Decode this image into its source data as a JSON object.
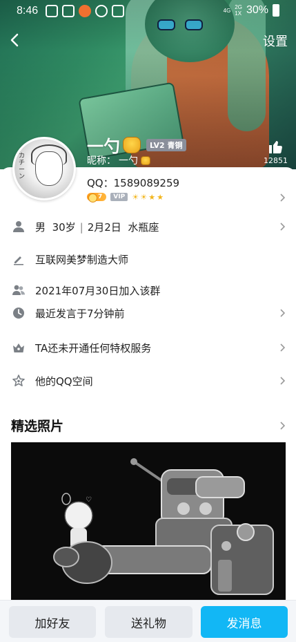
{
  "status_bar": {
    "time": "8:46",
    "net_top": "4G",
    "net_sim2": "2G",
    "net_sim2_sub": "1X",
    "battery": "30%"
  },
  "nav": {
    "settings_label": "设置"
  },
  "profile": {
    "name": "一勺",
    "level_badge": "LV2 青铜",
    "nickname_label": "昵称：",
    "nickname": "一勺",
    "like_count": "12851",
    "qq_label": "QQ：",
    "qq_number": "1589089259",
    "badge_gold_text": "7",
    "badge_vip_text": "VIP",
    "avatar_side_text": "カチーン"
  },
  "info_rows": [
    {
      "icon": "person-icon",
      "gender": "男",
      "age": "30岁",
      "birthday": "2月2日",
      "zodiac": "水瓶座"
    },
    {
      "icon": "pen-icon",
      "text": "互联网美梦制造大师"
    },
    {
      "icon": "group-icon",
      "text": "2021年07月30日加入该群"
    },
    {
      "icon": "clock-icon",
      "text": "最近发言于7分钟前"
    },
    {
      "icon": "privilege-icon",
      "text": "TA还未开通任何特权服务"
    },
    {
      "icon": "star-icon",
      "text": "他的QQ空间"
    }
  ],
  "photos_section": {
    "title": "精选照片"
  },
  "bottom_bar": {
    "add_friend": "加好友",
    "send_gift": "送礼物",
    "send_message": "发消息"
  },
  "colors": {
    "accent_blue": "#12b7f5",
    "banner_green": "#2f8a62",
    "gold_badge": "#ff9b1a"
  }
}
